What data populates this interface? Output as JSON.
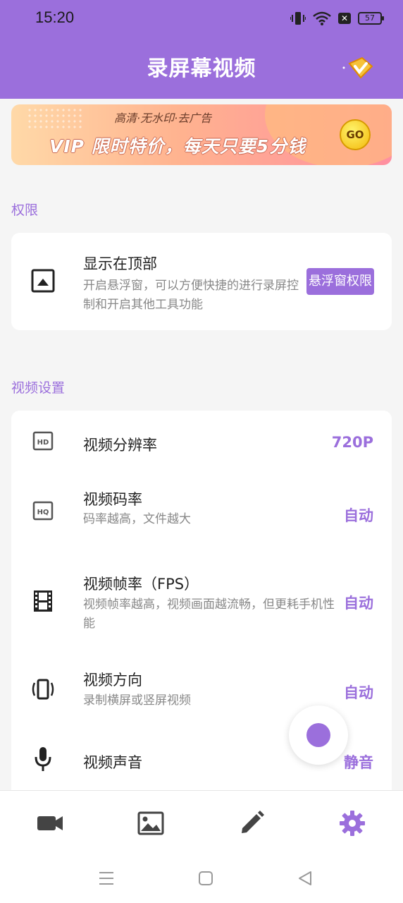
{
  "status_bar": {
    "time": "15:20",
    "battery": "57"
  },
  "app": {
    "title": "录屏幕视频"
  },
  "banner": {
    "subtitle": "高清·无水印·去广告",
    "headline": "VIP 限时特价，每天只要5分钱",
    "go_label": "GO"
  },
  "permissions": {
    "section_title": "权限",
    "item": {
      "title": "显示在顶部",
      "description": "开启悬浮窗，可以方便快捷的进行录屏控制和开启其他工具功能",
      "button_label": "悬浮窗权限"
    }
  },
  "video_settings": {
    "section_title": "视频设置",
    "items": [
      {
        "title": "视频分辨率",
        "description": "",
        "value": "720P",
        "icon": "hd-icon"
      },
      {
        "title": "视频码率",
        "description": "码率越高，文件越大",
        "value": "自动",
        "icon": "hq-icon"
      },
      {
        "title": "视频帧率（FPS）",
        "description": "视频帧率越高，视频画面越流畅，但更耗手机性能",
        "value": "自动",
        "icon": "film-icon"
      },
      {
        "title": "视频方向",
        "description": "录制横屏或竖屏视频",
        "value": "自动",
        "icon": "rotate-phone-icon"
      },
      {
        "title": "视频声音",
        "description": "",
        "value": "静音",
        "icon": "microphone-icon"
      }
    ]
  },
  "bottom_nav": {
    "items": [
      "video-camera-icon",
      "gallery-icon",
      "edit-pencil-icon",
      "settings-gear-icon"
    ],
    "active": "settings-gear-icon"
  },
  "colors": {
    "accent": "#9b6fdc",
    "background": "#f5f5f5",
    "card": "#ffffff"
  }
}
